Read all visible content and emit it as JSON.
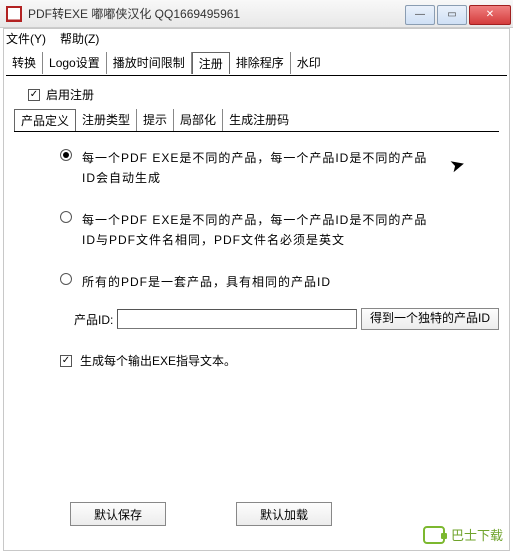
{
  "title": "PDF转EXE   嘟嘟侠汉化 QQ1669495961",
  "menubar": {
    "file": "文件(Y)",
    "help": "帮助(Z)"
  },
  "tabs": {
    "convert": "转换",
    "logo": "Logo设置",
    "playtime": "播放时间限制",
    "register": "注册",
    "exclude": "排除程序",
    "watermark": "水印"
  },
  "panel": {
    "enable_register": "启用注册",
    "sub_tabs": {
      "product_def": "产品定义",
      "reg_type": "注册类型",
      "tip": "提示",
      "localize": "局部化",
      "gen_code": "生成注册码"
    },
    "radios": {
      "opt1": "每一个PDF EXE是不同的产品，每一个产品ID是不同的产品ID会自动生成",
      "opt2": "每一个PDF EXE是不同的产品，每一个产品ID是不同的产品ID与PDF文件名相同，PDF文件名必须是英文",
      "opt3": "所有的PDF是一套产品，具有相同的产品ID"
    },
    "product_id_label": "产品ID:",
    "product_id_value": "",
    "unique_id_btn": "得到一个独特的产品ID",
    "gen_text_checkbox": "生成每个输出EXE指导文本。"
  },
  "buttons": {
    "default_save": "默认保存",
    "default_load": "默认加载"
  },
  "watermark": "巴士下载",
  "win": {
    "min": "—",
    "max": "▭",
    "close": "✕"
  }
}
